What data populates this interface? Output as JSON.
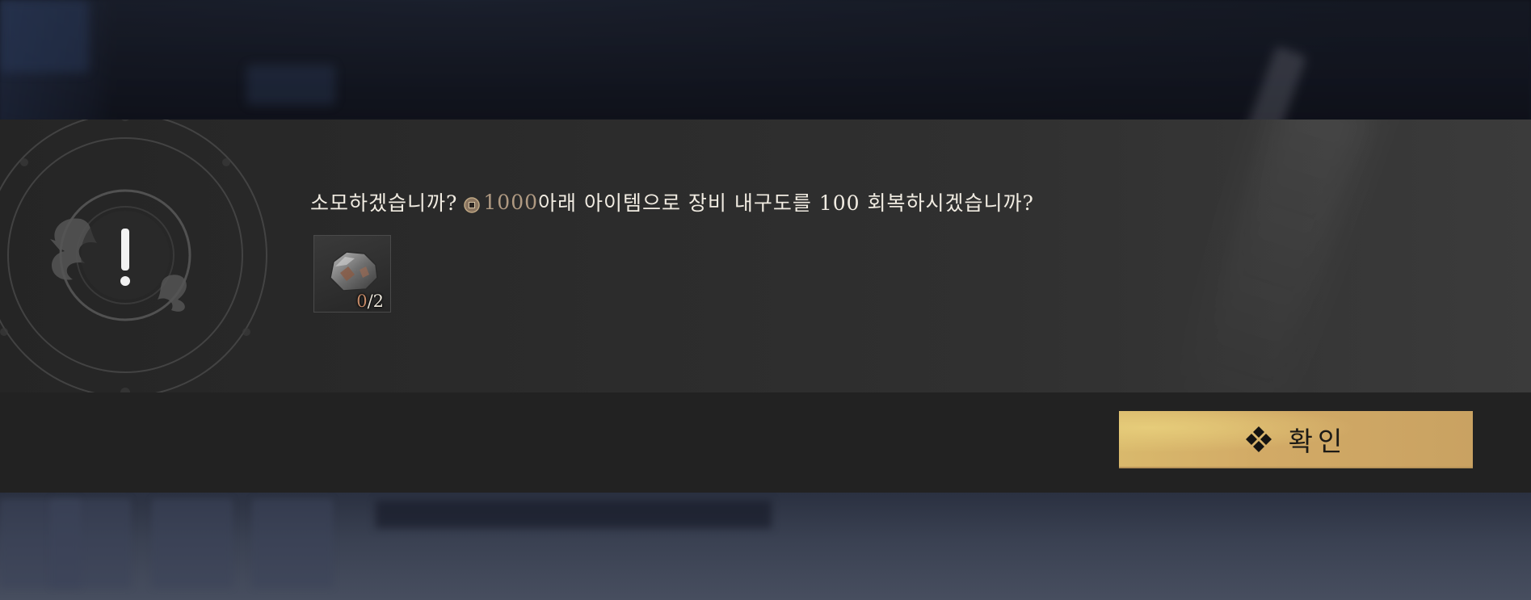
{
  "dialog": {
    "alert_icon": "exclamation-emblem-icon",
    "message_prefix": "소모하겠습니까?",
    "currency_icon": "coin-icon",
    "cost": "1000",
    "message_suffix": "아래 아이템으로 장비 내구도를 100 회복하시겠습니까?",
    "item": {
      "icon": "ore-material-icon",
      "have": "0",
      "need": "/2"
    },
    "confirm_icon": "diamond-cluster-icon",
    "confirm_label": "확인"
  },
  "colors": {
    "cost_text": "#b09a82",
    "button_gold": "#d2aa66",
    "count_have": "#c48a68"
  }
}
